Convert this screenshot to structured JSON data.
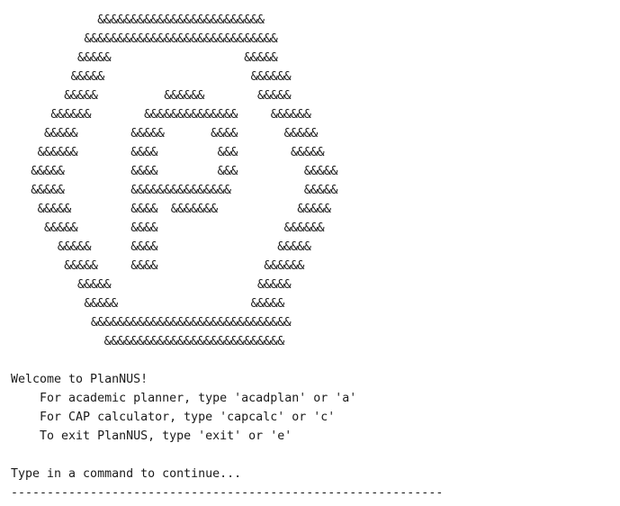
{
  "logo": {
    "lines": [
      "             &&&&&&&&&&&&&&&&&&&&&&&&&",
      "           &&&&&&&&&&&&&&&&&&&&&&&&&&&&&",
      "          &&&&&                    &&&&&",
      "         &&&&&                      &&&&&&",
      "        &&&&&          &&&&&&        &&&&&",
      "      &&&&&&        &&&&&&&&&&&&&&     &&&&&&",
      "     &&&&&        &&&&&       &&&&       &&&&&",
      "    &&&&&&        &&&&         &&&        &&&&&",
      "   &&&&&          &&&&         &&&          &&&&&",
      "   &&&&&          &&&&&&&&&&&&&&&           &&&&&",
      "    &&&&&         &&&&  &&&&&&&            &&&&&",
      "     &&&&&        &&&&                   &&&&&&",
      "       &&&&&      &&&&                  &&&&&",
      "        &&&&&     &&&&                &&&&&&",
      "          &&&&&                      &&&&&",
      "           &&&&&                    &&&&&",
      "            &&&&&&&&&&&&&&&&&&&&&&&&&&&&&&",
      "              &&&&&&&&&&&&&&&&&&&&&&&&&&&"
    ]
  },
  "welcome": {
    "title": "Welcome to PlanNUS!",
    "option_planner": "    For academic planner, type 'acadplan' or 'a'",
    "option_cap": "    For CAP calculator, type 'capcalc' or 'c'",
    "option_exit": "    To exit PlanNUS, type 'exit' or 'e'"
  },
  "prompt": {
    "text": "Type in a command to continue...",
    "separator": "------------------------------------------------------------"
  }
}
